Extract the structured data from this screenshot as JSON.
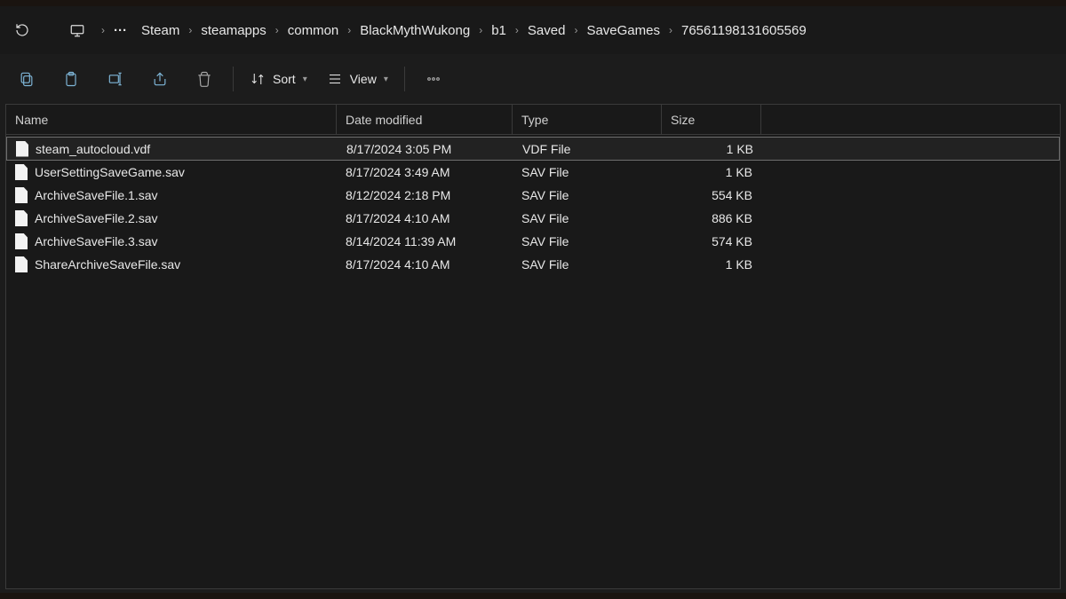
{
  "breadcrumb": {
    "overflow": "···",
    "items": [
      "Steam",
      "steamapps",
      "common",
      "BlackMythWukong",
      "b1",
      "Saved",
      "SaveGames",
      "76561198131605569"
    ]
  },
  "toolbar": {
    "sort_label": "Sort",
    "view_label": "View"
  },
  "columns": {
    "name": "Name",
    "date": "Date modified",
    "type": "Type",
    "size": "Size"
  },
  "files": [
    {
      "name": "steam_autocloud.vdf",
      "date": "8/17/2024 3:05 PM",
      "type": "VDF File",
      "size": "1 KB",
      "selected": true
    },
    {
      "name": "UserSettingSaveGame.sav",
      "date": "8/17/2024 3:49 AM",
      "type": "SAV File",
      "size": "1 KB",
      "selected": false
    },
    {
      "name": "ArchiveSaveFile.1.sav",
      "date": "8/12/2024 2:18 PM",
      "type": "SAV File",
      "size": "554 KB",
      "selected": false
    },
    {
      "name": "ArchiveSaveFile.2.sav",
      "date": "8/17/2024 4:10 AM",
      "type": "SAV File",
      "size": "886 KB",
      "selected": false
    },
    {
      "name": "ArchiveSaveFile.3.sav",
      "date": "8/14/2024 11:39 AM",
      "type": "SAV File",
      "size": "574 KB",
      "selected": false
    },
    {
      "name": "ShareArchiveSaveFile.sav",
      "date": "8/17/2024 4:10 AM",
      "type": "SAV File",
      "size": "1 KB",
      "selected": false
    }
  ]
}
